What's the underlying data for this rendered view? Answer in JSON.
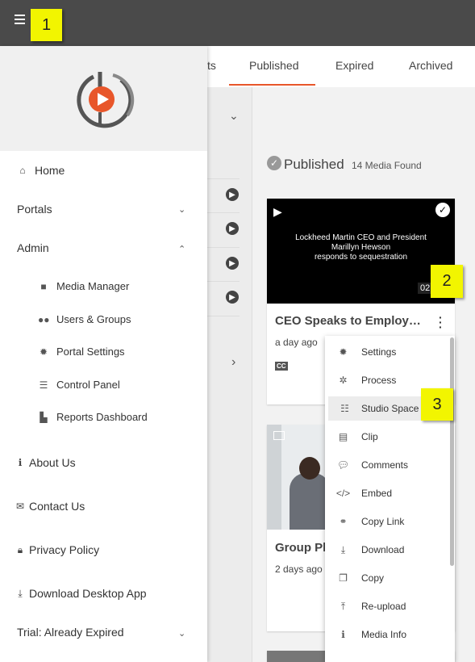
{
  "top_bar": {
    "menu_icon": "hamburger-icon"
  },
  "callouts": [
    "1",
    "2",
    "3"
  ],
  "tabs": [
    {
      "label": "ts"
    },
    {
      "label": "Published"
    },
    {
      "label": "Expired"
    },
    {
      "label": "Archived"
    }
  ],
  "main": {
    "section_title": "Published",
    "media_count": "14 Media Found",
    "cards": [
      {
        "thumb_text_line1": "Lockheed Martin CEO and President",
        "thumb_text_line2": "Marillyn Hewson",
        "thumb_text_line3": "responds to sequestration",
        "duration": "02",
        "title": "CEO Speaks to Employ…",
        "meta": "a day ago",
        "cc": "CC"
      },
      {
        "title": "Group Pl",
        "meta": "2 days ago"
      }
    ]
  },
  "drawer": {
    "items": [
      {
        "label": "Home",
        "icon": "home-icon"
      },
      {
        "label": "Portals",
        "icon": "chevron-down-icon"
      },
      {
        "label": "Admin",
        "icon": "chevron-up-icon"
      }
    ],
    "admin_sub": [
      {
        "label": "Media Manager",
        "icon": "folder-icon"
      },
      {
        "label": "Users & Groups",
        "icon": "users-icon"
      },
      {
        "label": "Portal Settings",
        "icon": "gear-icon"
      },
      {
        "label": "Control Panel",
        "icon": "list-icon"
      },
      {
        "label": "Reports Dashboard",
        "icon": "chart-icon"
      }
    ],
    "footer_items": [
      {
        "label": "About Us",
        "icon": "info-icon"
      },
      {
        "label": "Contact Us",
        "icon": "envelope-icon"
      },
      {
        "label": "Privacy Policy",
        "icon": "lock-icon"
      },
      {
        "label": "Download Desktop App",
        "icon": "download-icon"
      },
      {
        "label": "Trial: Already Expired",
        "icon": "chevron-down-icon"
      }
    ]
  },
  "context_menu": [
    {
      "label": "Settings",
      "icon": "gear-icon"
    },
    {
      "label": "Process",
      "icon": "cogs-icon"
    },
    {
      "label": "Studio Space",
      "icon": "sliders-icon"
    },
    {
      "label": "Clip",
      "icon": "film-icon"
    },
    {
      "label": "Comments",
      "icon": "comments-icon"
    },
    {
      "label": "Embed",
      "icon": "code-icon"
    },
    {
      "label": "Copy Link",
      "icon": "link-icon"
    },
    {
      "label": "Download",
      "icon": "download-icon"
    },
    {
      "label": "Copy",
      "icon": "copy-icon"
    },
    {
      "label": "Re-upload",
      "icon": "upload-icon"
    },
    {
      "label": "Media Info",
      "icon": "info-icon"
    }
  ],
  "colors": {
    "accent": "#e8562a",
    "topbar": "#4a4a4a",
    "callout": "#f2f500"
  }
}
